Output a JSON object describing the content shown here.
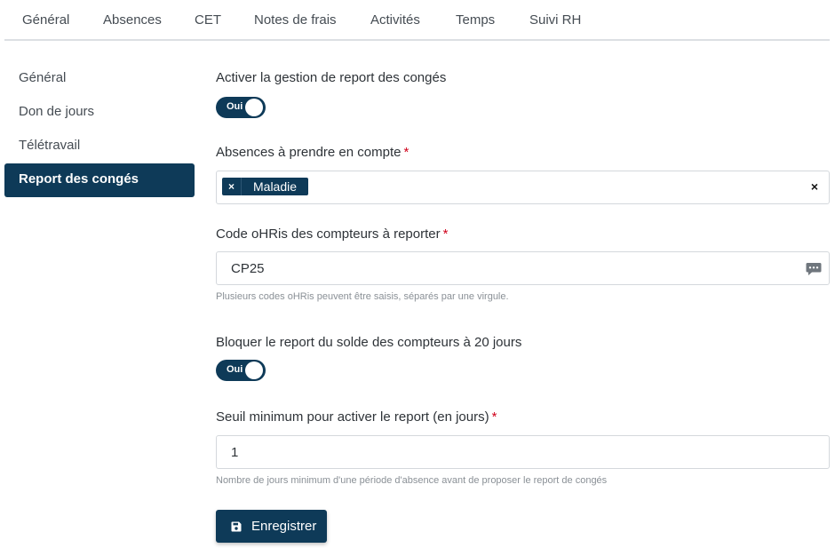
{
  "tabs": [
    {
      "label": "Général"
    },
    {
      "label": "Absences"
    },
    {
      "label": "CET"
    },
    {
      "label": "Notes de frais"
    },
    {
      "label": "Activités"
    },
    {
      "label": "Temps"
    },
    {
      "label": "Suivi RH"
    }
  ],
  "sidebar": {
    "items": [
      {
        "label": "Général"
      },
      {
        "label": "Don de jours"
      },
      {
        "label": "Télétravail"
      },
      {
        "label": "Report des congés"
      }
    ],
    "active_index": 3
  },
  "form": {
    "enable_label": "Activer la gestion de report des congés",
    "enable_toggle": "Oui",
    "absences_label": "Absences à prendre en compte",
    "absences_required": "*",
    "absences_chip": "Maladie",
    "absences_chip_remove": "×",
    "absences_clear": "×",
    "code_label": "Code oHRis des compteurs à reporter",
    "code_required": "*",
    "code_value": "CP25",
    "code_help": "Plusieurs codes oHRis peuvent être saisis, séparés par une virgule.",
    "block_label": "Bloquer le report du solde des compteurs à 20 jours",
    "block_toggle": "Oui",
    "threshold_label": "Seuil minimum pour activer le report (en jours)",
    "threshold_required": "*",
    "threshold_value": "1",
    "threshold_help": "Nombre de jours minimum d'une période d'absence avant de proposer le report de congés",
    "save_label": "Enregistrer"
  },
  "colors": {
    "primary": "#0e3a58",
    "required": "#d0021b"
  },
  "icons": {
    "comment": "comment-dots-icon",
    "save": "floppy-disk-icon"
  }
}
